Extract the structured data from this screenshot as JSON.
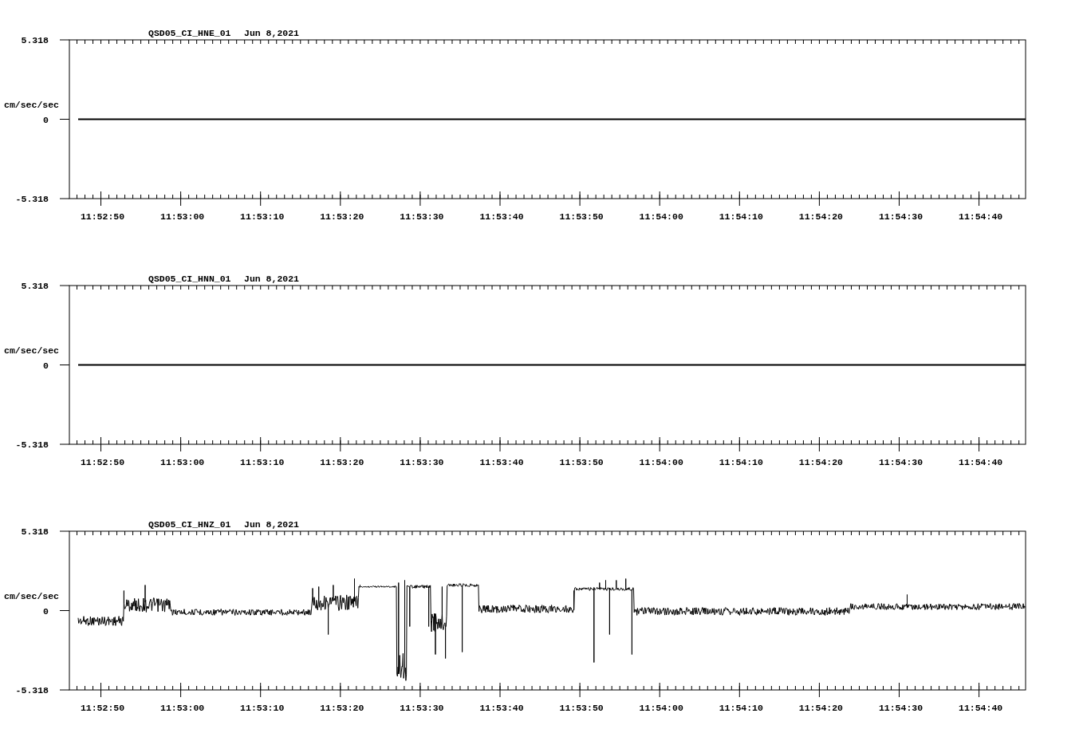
{
  "panels": [
    {
      "station": "QSD05_CI_HNE_01",
      "date": "Jun 8,2021",
      "ylabel": "cm/sec/sec",
      "yticks": [
        "5.318",
        "0",
        "-5.318"
      ],
      "xticks": [
        "11:52:50",
        "11:53:00",
        "11:53:10",
        "11:53:20",
        "11:53:30",
        "11:53:40",
        "11:53:50",
        "11:54:00",
        "11:54:10",
        "11:54:20",
        "11:54:30",
        "11:54:40"
      ],
      "kind": "flat"
    },
    {
      "station": "QSD05_CI_HNN_01",
      "date": "Jun 8,2021",
      "ylabel": "cm/sec/sec",
      "yticks": [
        "5.318",
        "0",
        "-5.318"
      ],
      "xticks": [
        "11:52:50",
        "11:53:00",
        "11:53:10",
        "11:53:20",
        "11:53:30",
        "11:53:40",
        "11:53:50",
        "11:54:00",
        "11:54:10",
        "11:54:20",
        "11:54:30",
        "11:54:40"
      ],
      "kind": "flat"
    },
    {
      "station": "QSD05_CI_HNZ_01",
      "date": "Jun 8,2021",
      "ylabel": "cm/sec/sec",
      "yticks": [
        "5.318",
        "0",
        "-5.318"
      ],
      "xticks": [
        "11:52:50",
        "11:53:00",
        "11:53:10",
        "11:53:20",
        "11:53:30",
        "11:53:40",
        "11:53:50",
        "11:54:00",
        "11:54:10",
        "11:54:20",
        "11:54:30",
        "11:54:40"
      ],
      "kind": "signal"
    }
  ]
}
